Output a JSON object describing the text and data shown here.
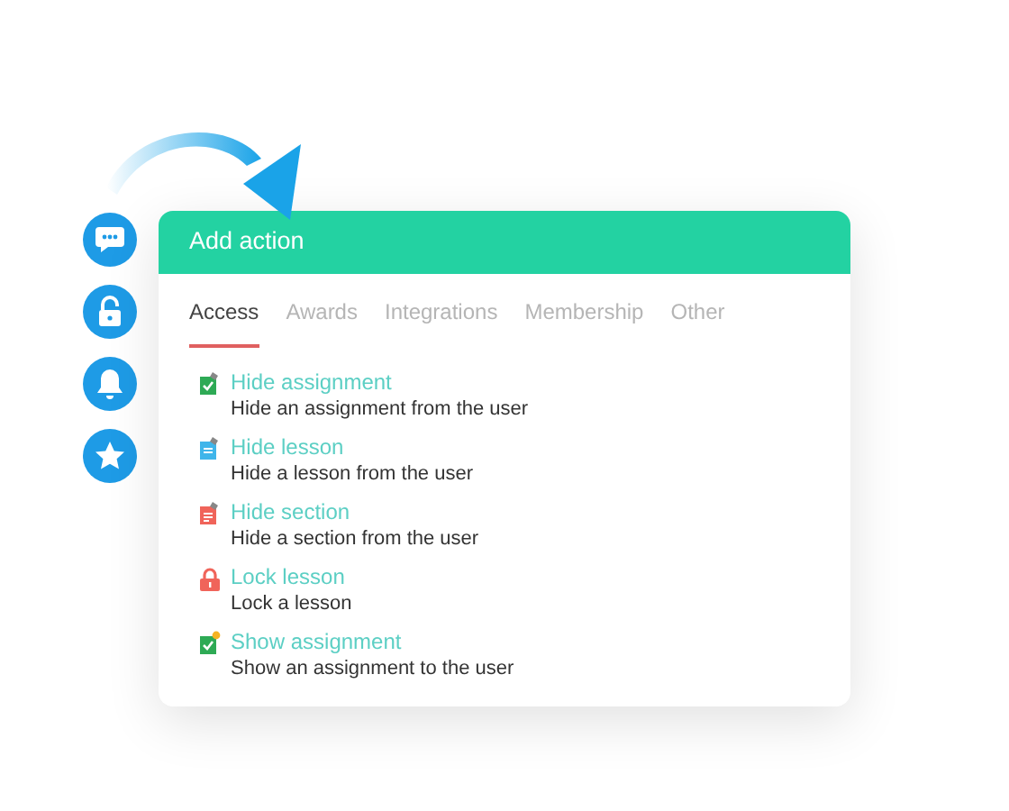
{
  "side_icons": [
    {
      "kind": "chat"
    },
    {
      "kind": "unlock"
    },
    {
      "kind": "bell"
    },
    {
      "kind": "star"
    }
  ],
  "panel": {
    "title": "Add action",
    "tabs": [
      {
        "label": "Access",
        "selected": true
      },
      {
        "label": "Awards",
        "selected": false
      },
      {
        "label": "Integrations",
        "selected": false
      },
      {
        "label": "Membership",
        "selected": false
      },
      {
        "label": "Other",
        "selected": false
      }
    ],
    "actions": [
      {
        "kind": "assignment",
        "color": "#2eaa55",
        "title": "Hide assignment",
        "description": "Hide an assignment from the user"
      },
      {
        "kind": "lesson",
        "color": "#3fb5ea",
        "title": "Hide lesson",
        "description": "Hide a lesson from the user"
      },
      {
        "kind": "section",
        "color": "#f0645a",
        "title": "Hide section",
        "description": "Hide a section from the user"
      },
      {
        "kind": "lock",
        "color": "#f0645a",
        "title": "Lock lesson",
        "description": "Lock a lesson"
      },
      {
        "kind": "show",
        "color": "#2eaa55",
        "title": "Show assignment",
        "description": "Show an assignment to the user"
      }
    ]
  }
}
